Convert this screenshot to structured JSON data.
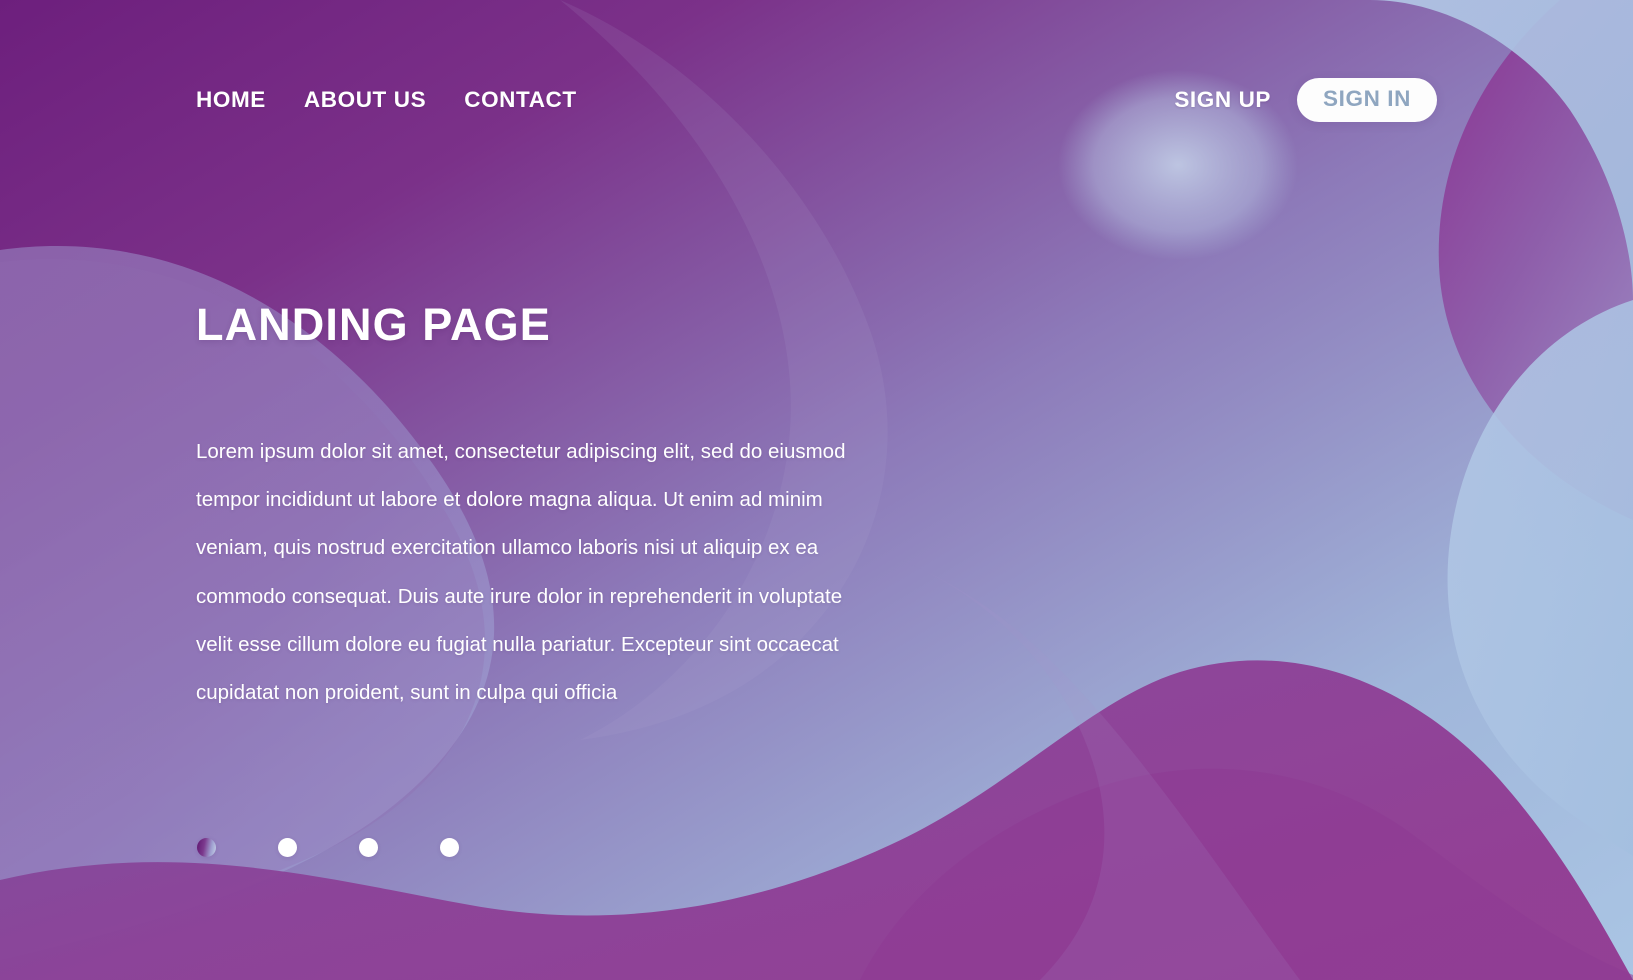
{
  "theme": {
    "deep_purple": "#6d1f7d",
    "mid_purple": "#8e4fa0",
    "lavender": "#8d86c4",
    "light_blue": "#a8c3e2",
    "white": "#ffffff",
    "signin_text": "#8fa6c0"
  },
  "nav": {
    "links": [
      {
        "label": "HOME",
        "name": "nav-link-home"
      },
      {
        "label": "ABOUT US",
        "name": "nav-link-about-us"
      },
      {
        "label": "CONTACT",
        "name": "nav-link-contact"
      }
    ],
    "sign_up_label": "SIGN UP",
    "sign_in_label": "SIGN IN"
  },
  "hero": {
    "title": "LANDING PAGE",
    "body": "Lorem ipsum dolor sit amet, consectetur adipiscing elit, sed do eiusmod tempor incididunt ut labore et dolore magna aliqua. Ut enim ad minim veniam, quis nostrud exercitation ullamco laboris nisi ut aliquip ex ea commodo consequat. Duis aute irure dolor in reprehenderit in voluptate velit esse cillum dolore eu fugiat nulla pariatur. Excepteur sint occaecat cupidatat non proident, sunt in culpa qui officia"
  },
  "carousel": {
    "dots": [
      {
        "index": 1,
        "active": true
      },
      {
        "index": 2,
        "active": false
      },
      {
        "index": 3,
        "active": false
      },
      {
        "index": 4,
        "active": false
      }
    ]
  }
}
